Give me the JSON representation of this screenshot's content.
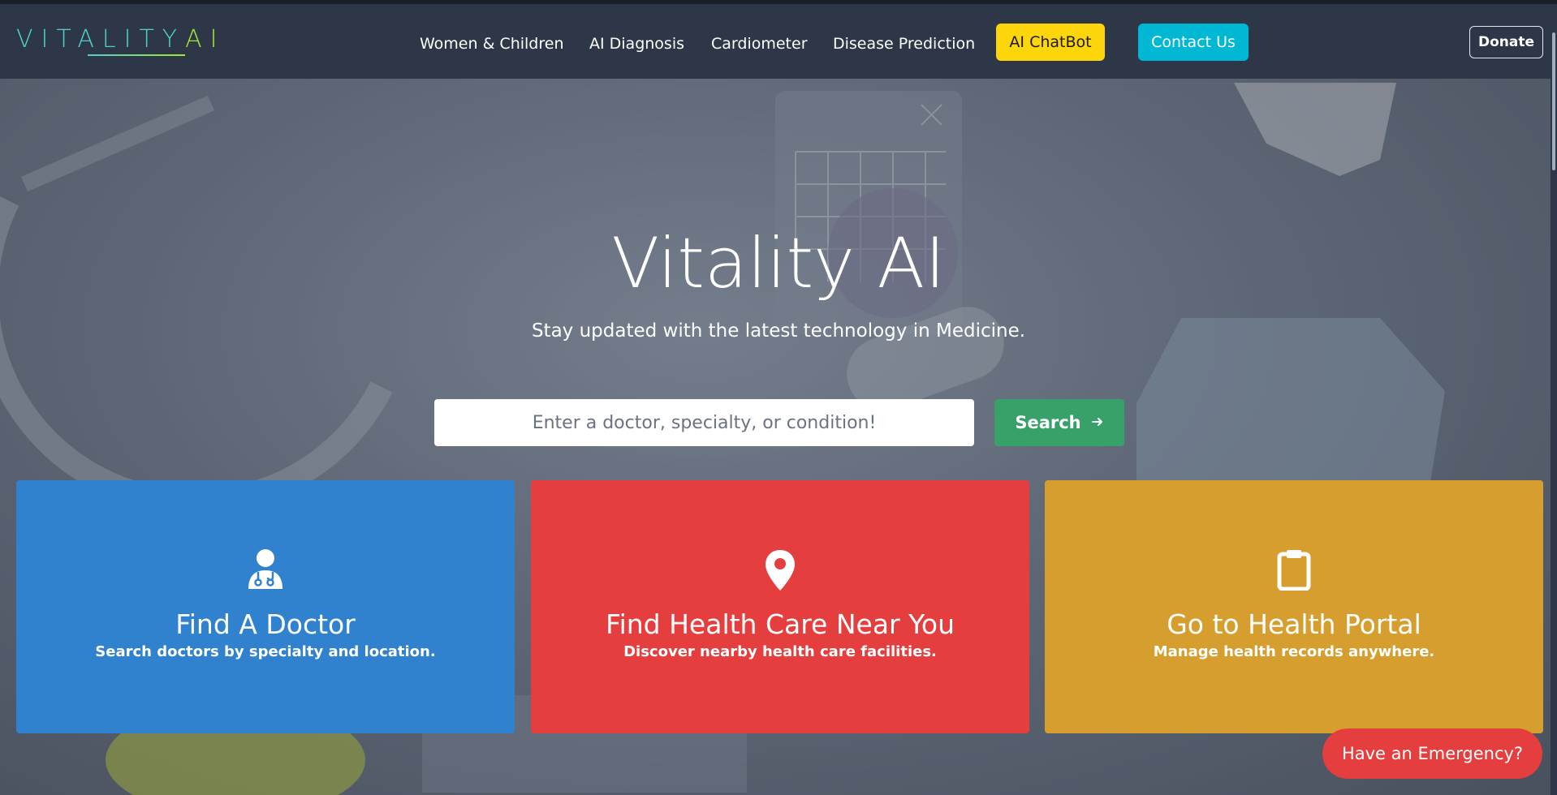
{
  "brand": {
    "logo_text_left": "VITALITY",
    "logo_text_right": "AI"
  },
  "nav": {
    "links": [
      {
        "label": "Women & Children"
      },
      {
        "label": "AI Diagnosis"
      },
      {
        "label": "Cardiometer"
      },
      {
        "label": "Disease Prediction"
      }
    ],
    "chatbot_label": "AI ChatBot",
    "contact_label": "Contact Us",
    "donate_label": "Donate"
  },
  "hero": {
    "title": "Vitality AI",
    "subtitle": "Stay updated with the latest technology in Medicine.",
    "search_placeholder": "Enter a doctor, specialty, or condition!",
    "search_button": "Search",
    "search_button_icon": "arrow-right-icon"
  },
  "cards": [
    {
      "title": "Find A Doctor",
      "description": "Search doctors by specialty and location.",
      "icon": "doctor-icon",
      "color": "#3182ce"
    },
    {
      "title": "Find Health Care Near You",
      "description": "Discover nearby health care facilities.",
      "icon": "map-pin-icon",
      "color": "#e53e3e"
    },
    {
      "title": "Go to Health Portal",
      "description": "Manage health records anywhere.",
      "icon": "clipboard-icon",
      "color": "#d69e2e"
    }
  ],
  "emergency_label": "Have an Emergency?",
  "colors": {
    "navbar": "#2d3748",
    "chatbot": "#fcd50a",
    "contact": "#00b8d4",
    "search": "#38a169",
    "emergency": "#e53e3e"
  }
}
